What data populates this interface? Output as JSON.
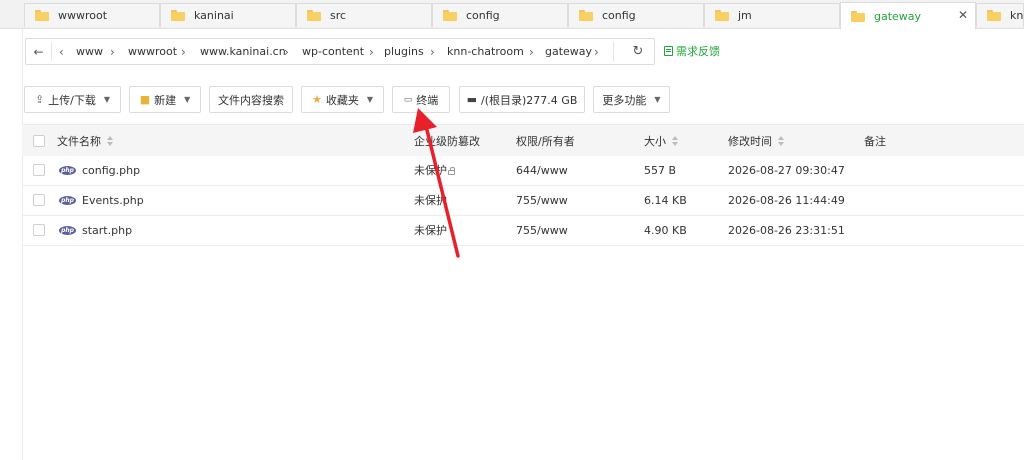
{
  "tabs": [
    {
      "label": "wwwroot"
    },
    {
      "label": "kaninai"
    },
    {
      "label": "src"
    },
    {
      "label": "config"
    },
    {
      "label": "config"
    },
    {
      "label": "jm"
    },
    {
      "label": "gateway",
      "active": true
    },
    {
      "label": "knn-"
    }
  ],
  "address": {
    "back_icon": "back-arrow-icon",
    "breadcrumbs": [
      "www",
      "wwwroot",
      "www.kaninai.cn",
      "wp-content",
      "plugins",
      "knn-chatroom",
      "gateway"
    ],
    "refresh_icon": "refresh-icon"
  },
  "request_feedback": "需求反馈",
  "toolbar": {
    "upload": "上传/下载",
    "new": "新建",
    "search_content": "文件内容搜索",
    "favorites": "收藏夹",
    "terminal": "终端",
    "disk": "/(根目录)277.4 GB",
    "more": "更多功能"
  },
  "table": {
    "headers": {
      "name": "文件名称",
      "tamper": "企业级防篡改",
      "perm": "权限/所有者",
      "size": "大小",
      "mtime": "修改时间",
      "note": "备注"
    },
    "rows": [
      {
        "name": "config.php",
        "tamper": "未保护",
        "perm": "644/www",
        "size": "557 B",
        "mtime": "2026-08-27 09:30:47"
      },
      {
        "name": "Events.php",
        "tamper": "未保护",
        "perm": "755/www",
        "size": "6.14 KB",
        "mtime": "2026-08-26 11:44:49"
      },
      {
        "name": "start.php",
        "tamper": "未保护",
        "perm": "755/www",
        "size": "4.90 KB",
        "mtime": "2026-08-26 23:31:51"
      }
    ]
  },
  "colors": {
    "accent": "#20a53a",
    "arrow": "#e8202a",
    "php_badge": "#5a5f99",
    "folder": "#f7cf63"
  }
}
